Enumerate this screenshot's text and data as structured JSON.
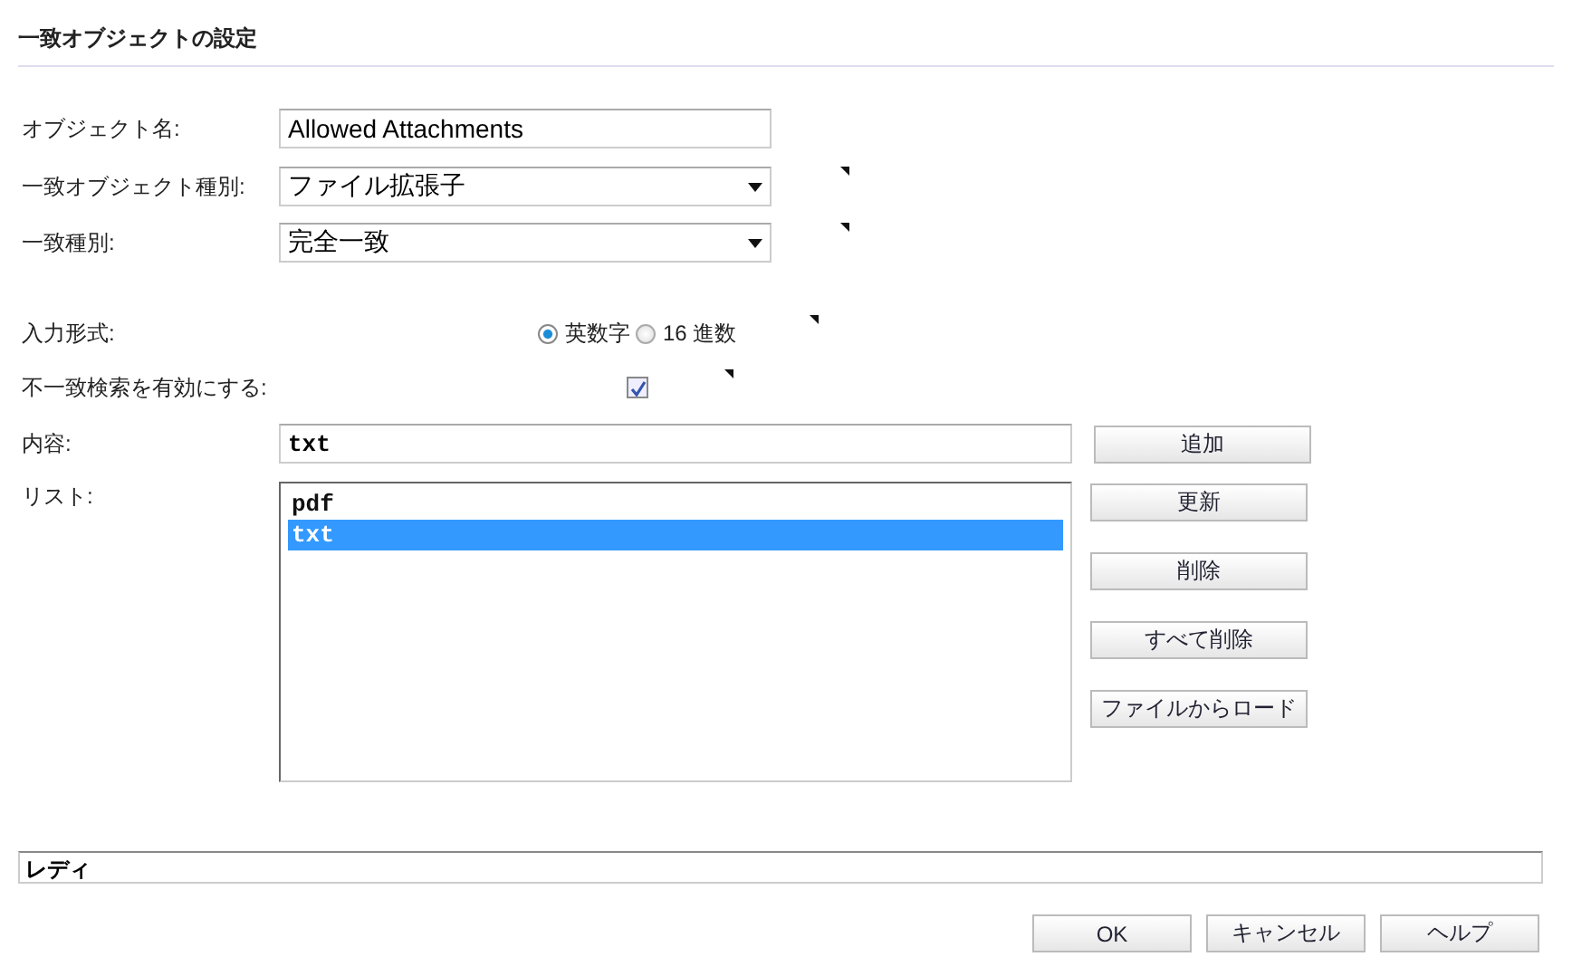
{
  "title": "一致オブジェクトの設定",
  "fields": [
    {
      "kind": "text",
      "label": "オブジェクト名:",
      "value": "Allowed Attachments"
    },
    {
      "kind": "select",
      "label": "一致オブジェクト種別:",
      "value": "ファイル拡張子"
    },
    {
      "kind": "select",
      "label": "一致種別:",
      "value": "完全一致"
    },
    {
      "kind": "radio",
      "label": "入力形式:",
      "options": [
        {
          "label": "英数字",
          "selected": true
        },
        {
          "label": "16 進数",
          "selected": false
        }
      ]
    },
    {
      "kind": "checkbox",
      "label": "不一致検索を有効にする:",
      "checked": true
    }
  ],
  "content": {
    "label": "内容:",
    "value": "txt",
    "button": "追加"
  },
  "list": {
    "label": "リスト:",
    "items": [
      {
        "text": "pdf",
        "selected": false
      },
      {
        "text": "txt",
        "selected": true
      }
    ],
    "buttons": [
      "更新",
      "削除",
      "すべて削除",
      "ファイルからロード"
    ]
  },
  "status_bar": "レディ",
  "buttons": [
    "OK",
    "キャンセル",
    "ヘルプ"
  ]
}
